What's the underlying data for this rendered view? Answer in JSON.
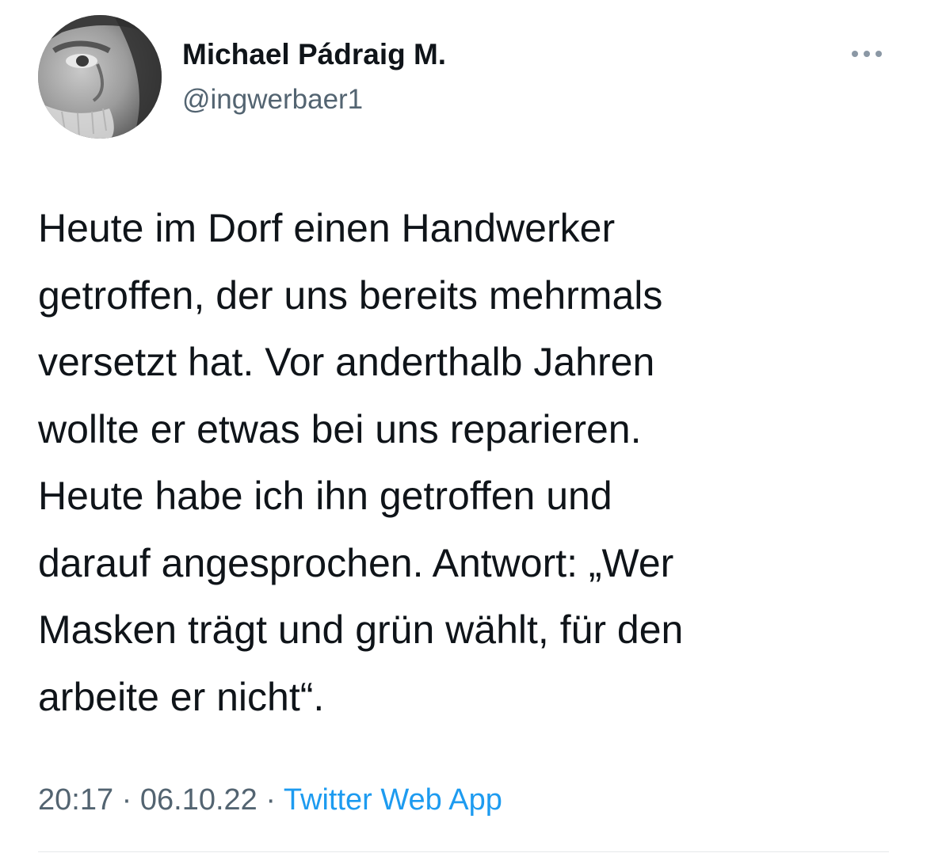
{
  "tweet": {
    "author": {
      "display_name": "Michael Pádraig M.",
      "handle": "@ingwerbaer1",
      "avatar_icon": "profile-photo-grayscale-face"
    },
    "more_icon": "more-horizontal-icon",
    "text_lines": [
      "Heute im Dorf einen Handwerker",
      "getroffen, der uns bereits mehrmals",
      "versetzt hat. Vor anderthalb Jahren",
      "wollte er etwas bei uns reparieren.",
      "Heute habe ich ihn getroffen und",
      "darauf angesprochen. Antwort: „Wer",
      "Masken trägt und grün wählt, für den",
      "arbeite er nicht“."
    ],
    "meta": {
      "time": "20:17",
      "date": "06.10.22",
      "separator": "·",
      "source": "Twitter Web App"
    }
  },
  "colors": {
    "text_primary": "#0f1419",
    "text_secondary": "#536471",
    "link": "#1d9bf0",
    "divider": "#e6e9eb"
  }
}
